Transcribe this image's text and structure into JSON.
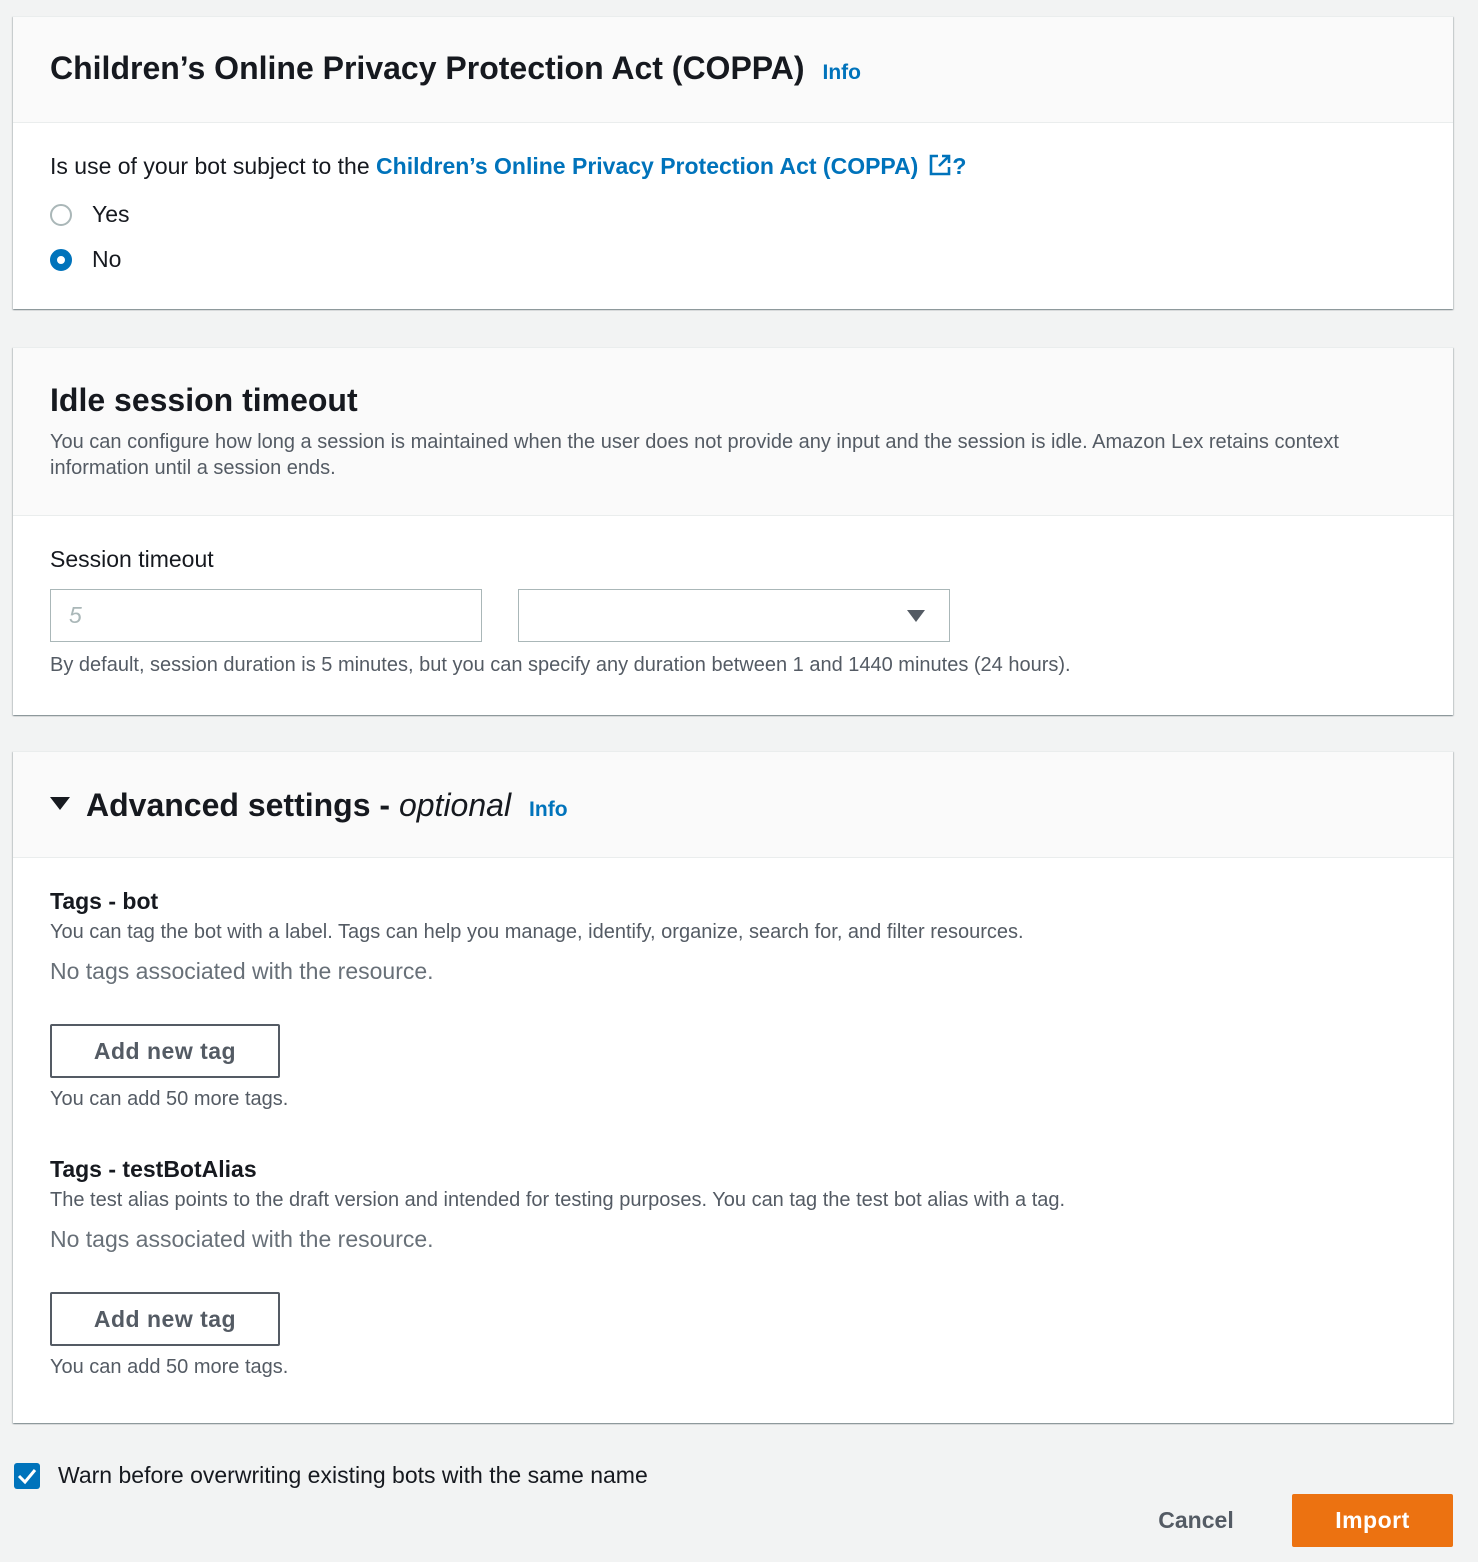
{
  "coppa": {
    "title": "Children’s Online Privacy Protection Act (COPPA)",
    "info": "Info",
    "question_prefix": "Is use of your bot subject to the ",
    "question_link": "Children’s Online Privacy Protection Act (COPPA)",
    "question_suffix": "?",
    "link_icon": "external-link-icon",
    "options": [
      {
        "label": "Yes",
        "checked": false
      },
      {
        "label": "No",
        "checked": true
      }
    ]
  },
  "idle_session": {
    "title": "Idle session timeout",
    "description": "You can configure how long a session is maintained when the user does not provide any input and the session is idle. Amazon Lex retains context information until a session ends.",
    "field_label": "Session timeout",
    "timeout_placeholder": "5",
    "unit_selected": "",
    "hint": "By default, session duration is 5 minutes, but you can specify any duration between 1 and 1440 minutes (24 hours)."
  },
  "advanced": {
    "title": "Advanced settings - ",
    "title_optional": "optional",
    "info": "Info",
    "tag_groups": [
      {
        "title": "Tags - bot",
        "description": "You can tag the bot with a label. Tags can help you manage, identify, organize, search for, and filter resources.",
        "empty_text": "No tags associated with the resource.",
        "button_label": "Add new tag",
        "remaining_text": "You can add 50 more tags."
      },
      {
        "title": "Tags - testBotAlias",
        "description": "The test alias points to the draft version and intended for testing purposes. You can tag the test bot alias with a tag.",
        "empty_text": "No tags associated with the resource.",
        "button_label": "Add new tag",
        "remaining_text": "You can add 50 more tags."
      }
    ]
  },
  "footer": {
    "warn_label": "Warn before overwriting existing bots with the same name",
    "warn_checked": true,
    "cancel_label": "Cancel",
    "import_label": "Import"
  },
  "colors": {
    "accent": "#0073bb",
    "primary_button": "#ec7211",
    "page_background": "#f2f3f3"
  }
}
